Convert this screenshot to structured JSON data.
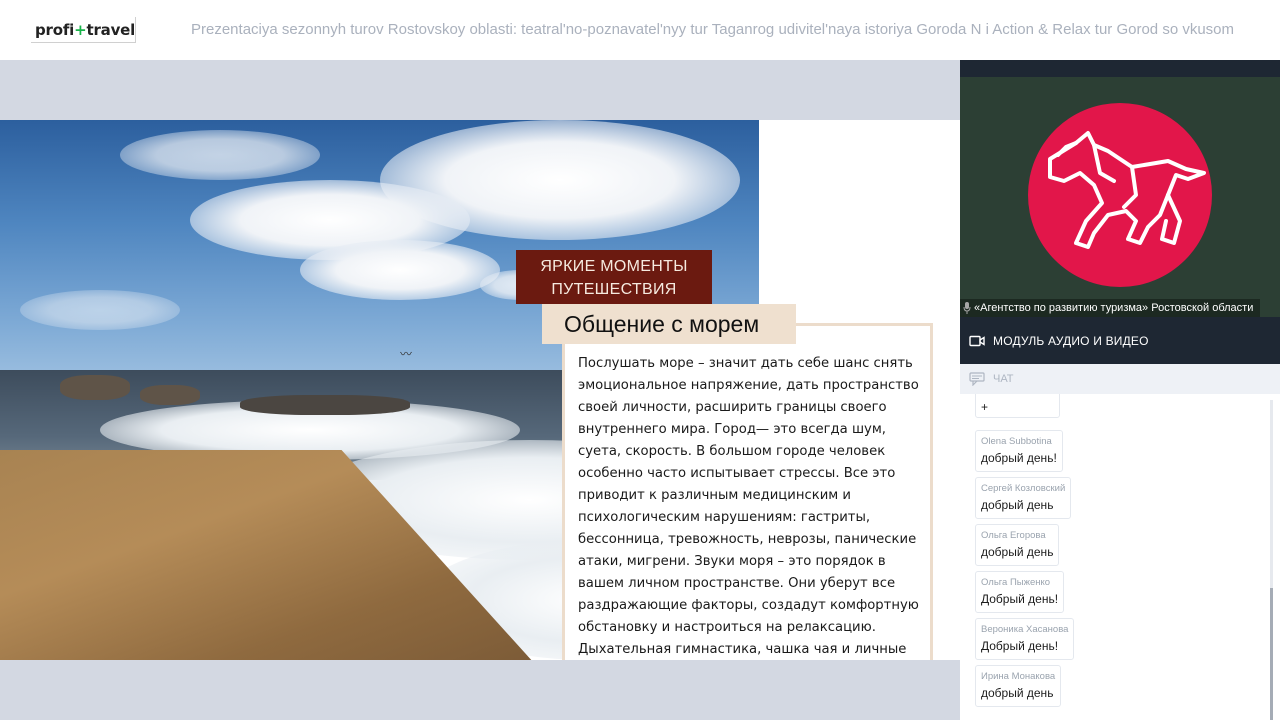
{
  "header": {
    "logo_left": "profi",
    "logo_plus": "+",
    "logo_right": "travel",
    "title": "Prezentaciya sezonnyh turov Rostovskoy oblasti: teatral'no-poznavatel'nyy tur Taganrog udivitel'naya istoriya Goroda N i Action & Relax tur Gorod so vkusom"
  },
  "slide": {
    "banner_line1": "ЯРКИЕ МОМЕНТЫ",
    "banner_line2": "ПУТЕШЕСТВИЯ",
    "heading": "Общение с морем",
    "body": "Послушать море – значит дать себе шанс снять эмоциональное напряжение, дать пространство своей личности, расширить границы своего внутреннего мира. Город— это всегда шум, суета, скорость. В большом городе человек особенно часто испытывает стрессы. Все это приводит к различным медицинским и психологическим нарушениям: гастриты, бессонница, тревожность, неврозы, панические атаки, мигрени. Звуки моря – это порядок в вашем личном пространстве. Они уберут все раздражающие факторы, создадут комфортную обстановку и настроиться на релаксацию. Дыхательная гимнастика, чашка чая и личные размышления, вы счастливы !"
  },
  "video": {
    "speaker_caption": "«Агентство по развитию туризма» Ростовской области",
    "badge_color": "#e2164a"
  },
  "av_module": {
    "label": "МОДУЛЬ АУДИО И ВИДЕО",
    "icon": "video-camera-icon"
  },
  "chat": {
    "label": "ЧАТ",
    "icon": "chat-icon",
    "partial_message": "+",
    "messages": [
      {
        "name": "Olena Subbotina",
        "text": "добрый день!"
      },
      {
        "name": "Сергей Козловский",
        "text": "добрый день"
      },
      {
        "name": "Ольга Егорова",
        "text": "добрый день"
      },
      {
        "name": "Ольга Пыженко",
        "text": "Добрый день!"
      },
      {
        "name": "Вероника Хасанова",
        "text": "Добрый день!"
      },
      {
        "name": "Ирина Монакова",
        "text": "добрый день"
      }
    ]
  }
}
